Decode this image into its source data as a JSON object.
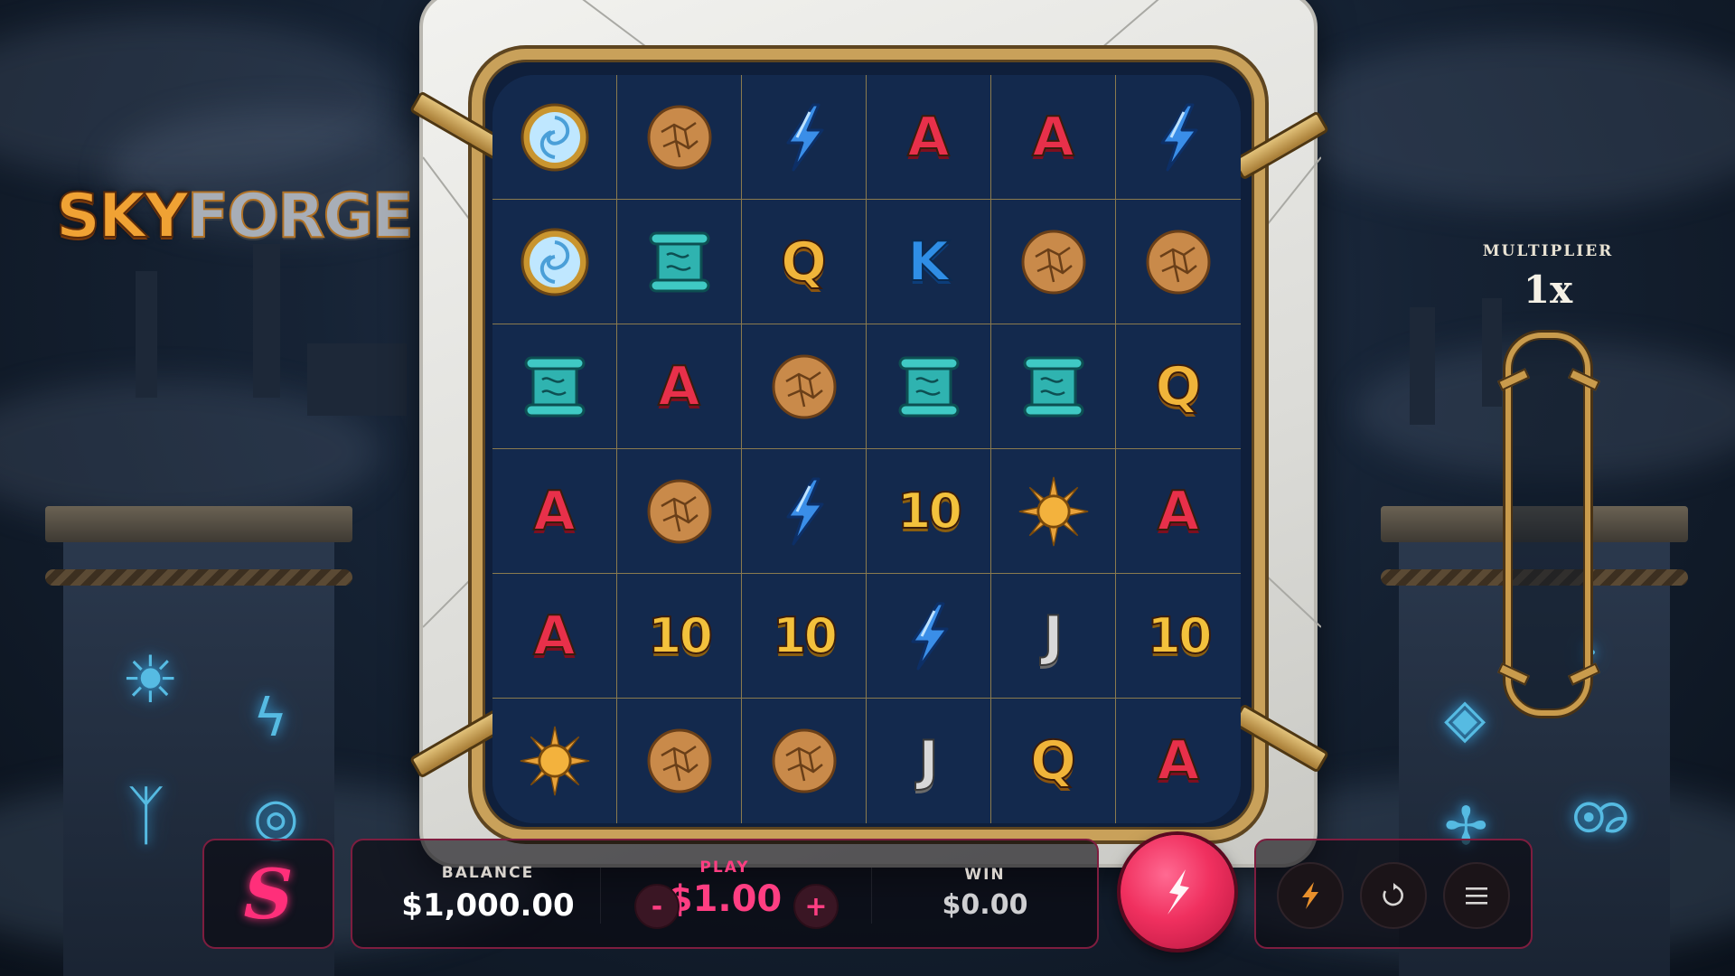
{
  "game": {
    "logo_sky": "SKY",
    "logo_forge": "FORGE"
  },
  "board": {
    "rows": [
      [
        "portal-icon",
        "cookie-icon",
        "lightning-icon",
        "A",
        "A",
        "lightning-icon"
      ],
      [
        "portal-icon",
        "scroll-icon",
        "Q",
        "K",
        "cookie-icon",
        "cookie-icon"
      ],
      [
        "scroll-icon",
        "A",
        "cookie-icon",
        "scroll-icon",
        "scroll-icon",
        "Q"
      ],
      [
        "A",
        "cookie-icon",
        "lightning-icon",
        "10",
        "sun-icon",
        "A"
      ],
      [
        "A",
        "10",
        "10",
        "lightning-icon",
        "J",
        "10"
      ],
      [
        "sun-icon",
        "cookie-icon",
        "cookie-icon",
        "J",
        "Q",
        "A"
      ]
    ]
  },
  "multiplier": {
    "label": "MULTIPLIER",
    "value": "1x",
    "fill_level": 0
  },
  "controls": {
    "brand": "S",
    "balance_label": "BALANCE",
    "balance_value": "$1,000.00",
    "play_label": "PLAY",
    "play_value": "$1.00",
    "decrease_label": "-",
    "increase_label": "+",
    "win_label": "WIN",
    "win_value": "$0.00",
    "spin_icon": "spin-bolt-icon",
    "turbo_icon": "turbo-bolt-icon",
    "autoplay_icon": "autoplay-icon",
    "menu_icon": "menu-icon"
  },
  "colors": {
    "accent": "#ff3e82",
    "frame_gold": "#c9a15a",
    "board_bg": "#13294d"
  }
}
